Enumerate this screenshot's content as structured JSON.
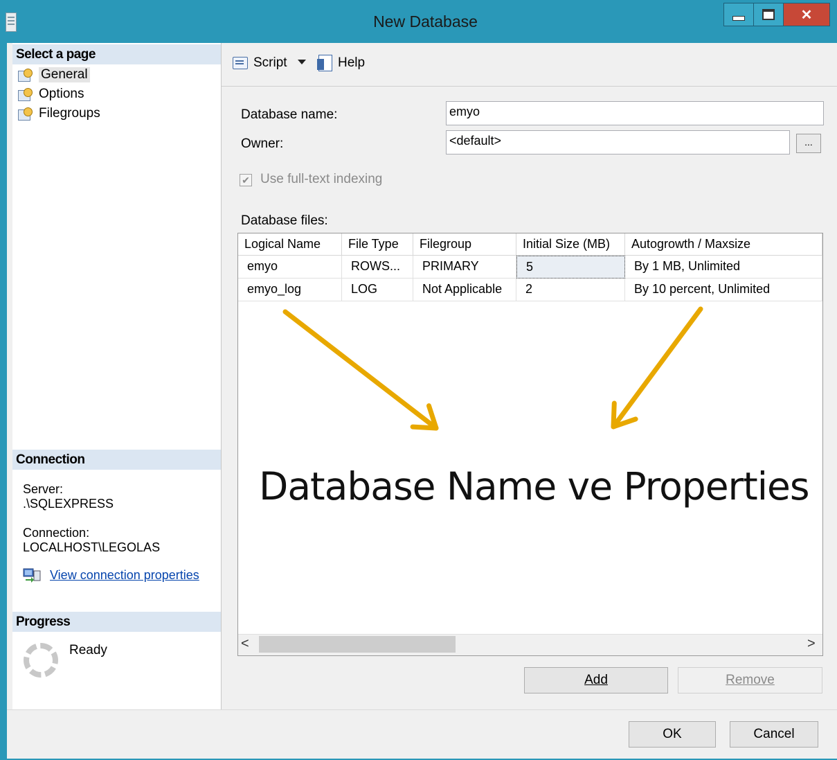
{
  "window": {
    "title": "New Database"
  },
  "left": {
    "select_page_header": "Select a page",
    "pages": [
      {
        "label": "General"
      },
      {
        "label": "Options"
      },
      {
        "label": "Filegroups"
      }
    ],
    "connection_header": "Connection",
    "server_label": "Server:",
    "server_value": ".\\SQLEXPRESS",
    "connection_label": "Connection:",
    "connection_value": "LOCALHOST\\LEGOLAS",
    "view_connection_link": "View connection properties",
    "progress_header": "Progress",
    "progress_status": "Ready"
  },
  "toolbar": {
    "script_label": "Script",
    "help_label": "Help"
  },
  "form": {
    "database_name_label": "Database name:",
    "database_name_value": "emyo",
    "owner_label": "Owner:",
    "owner_value": "<default>",
    "owner_browse_label": "...",
    "fulltext_label": "Use full-text indexing",
    "fulltext_checked": true,
    "database_files_label": "Database files:"
  },
  "grid": {
    "columns": [
      "Logical Name",
      "File Type",
      "Filegroup",
      "Initial Size (MB)",
      "Autogrowth / Maxsize"
    ],
    "rows": [
      [
        "emyo",
        "ROWS...",
        "PRIMARY",
        "5",
        "By 1 MB, Unlimited"
      ],
      [
        "emyo_log",
        "LOG",
        "Not Applicable",
        "2",
        "By 10 percent, Unlimited"
      ]
    ]
  },
  "buttons": {
    "add": "Add",
    "remove": "Remove",
    "ok": "OK",
    "cancel": "Cancel"
  },
  "annotation": {
    "text": "Database Name ve Properties",
    "arrow_color": "#e8a800"
  }
}
